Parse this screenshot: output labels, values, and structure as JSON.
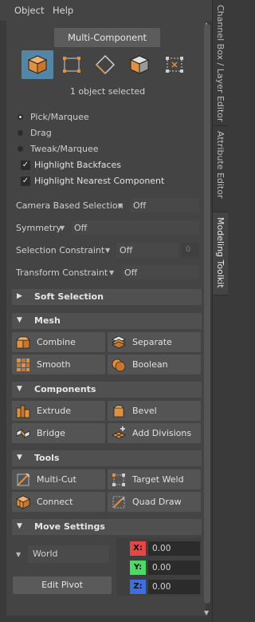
{
  "menu": {
    "object": "Object",
    "help": "Help"
  },
  "vertical_tabs": [
    {
      "label": "Channel Box / Layer Editor"
    },
    {
      "label": "Attribute Editor"
    },
    {
      "label": "Modeling Toolkit"
    }
  ],
  "mode": {
    "multi_component_label": "Multi-Component",
    "buttons": [
      {
        "name": "object-mode",
        "icon": "cube-object-icon",
        "active": true
      },
      {
        "name": "vertex-mode",
        "icon": "vertex-icon",
        "active": false
      },
      {
        "name": "edge-mode",
        "icon": "edge-icon",
        "active": false
      },
      {
        "name": "face-mode",
        "icon": "face-icon",
        "active": false
      },
      {
        "name": "uv-mode",
        "icon": "uv-icon",
        "active": false
      }
    ],
    "status": "1 object selected"
  },
  "selection": {
    "pick_marquee": "Pick/Marquee",
    "drag": "Drag",
    "tweak_marquee": "Tweak/Marquee",
    "highlight_backfaces": "Highlight Backfaces",
    "highlight_nearest_component": "Highlight Nearest Component"
  },
  "options": {
    "camera_based_selection": {
      "label": "Camera Based Selection",
      "value": "Off"
    },
    "symmetry": {
      "label": "Symmetry",
      "value": "Off"
    },
    "selection_constraint": {
      "label": "Selection Constraint",
      "value": "Off",
      "number": "0"
    },
    "transform_constraint": {
      "label": "Transform Constraint",
      "value": "Off"
    }
  },
  "sections": {
    "soft_selection": "Soft Selection",
    "mesh": "Mesh",
    "components": "Components",
    "tools": "Tools",
    "move_settings": "Move Settings"
  },
  "mesh_tools": {
    "combine": "Combine",
    "separate": "Separate",
    "smooth": "Smooth",
    "boolean": "Boolean"
  },
  "component_tools": {
    "extrude": "Extrude",
    "bevel": "Bevel",
    "bridge": "Bridge",
    "add_divisions": "Add Divisions"
  },
  "tools": {
    "multi_cut": "Multi-Cut",
    "target_weld": "Target Weld",
    "connect": "Connect",
    "quad_draw": "Quad Draw"
  },
  "move_settings": {
    "space": "World",
    "edit_pivot": "Edit Pivot",
    "x_label": "X:",
    "y_label": "Y:",
    "z_label": "Z:",
    "x": "0.00",
    "y": "0.00",
    "z": "0.00"
  },
  "colors": {
    "active_mode": "#5285a6",
    "cube_orange": "#e0913f",
    "x_axis": "#e84545",
    "y_axis": "#4cd964",
    "z_axis": "#3d6fe0"
  }
}
